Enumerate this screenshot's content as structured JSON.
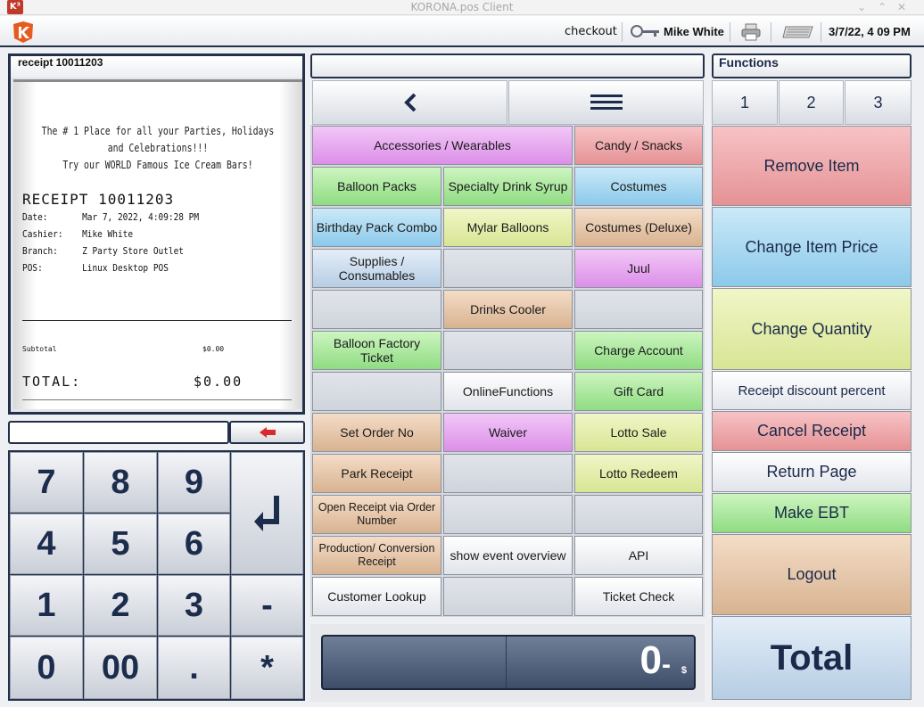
{
  "window": {
    "title": "KORONA.pos Client",
    "app_badge": "K³"
  },
  "header": {
    "mode": "checkout",
    "user": "Mike White",
    "datetime": "3/7/22, 4 09 PM"
  },
  "receipt": {
    "title": "receipt 10011203",
    "promo": [
      "The # 1 Place for all your Parties, Holidays",
      "and Celebrations!!!",
      "Try our WORLD Famous Ice Cream Bars!"
    ],
    "number_label": "RECEIPT 10011203",
    "fields": [
      {
        "k": "Date:",
        "v": "Mar 7, 2022, 4:09:28 PM"
      },
      {
        "k": "Cashier:",
        "v": "Mike White"
      },
      {
        "k": "Branch:",
        "v": "Z Party Store Outlet"
      },
      {
        "k": "POS:",
        "v": "Linux Desktop POS"
      }
    ],
    "subtotal_label": "Subtotal",
    "subtotal_value": "$0.00",
    "total_label": "TOTAL:",
    "total_value": "$0.00"
  },
  "keypad": {
    "keys": [
      "7",
      "8",
      "9",
      "4",
      "5",
      "6",
      "1",
      "2",
      "3",
      "-",
      "0",
      "00",
      ".",
      "*"
    ]
  },
  "products": {
    "buttons": [
      "Accessories / Wearables",
      "Candy / Snacks",
      "Balloon Packs",
      "Specialty Drink Syrup",
      "Costumes",
      "Birthday Pack Combo",
      "Mylar Balloons",
      "Costumes (Deluxe)",
      "Supplies / Consumables",
      "Juul",
      "Drinks Cooler",
      "Balloon Factory Ticket",
      "Charge Account",
      "OnlineFunctions",
      "Gift Card",
      "Set Order No",
      "Waiver",
      "Lotto Sale",
      "Park Receipt",
      "Lotto Redeem",
      "Open Receipt via Order Number",
      "Production/ Conversion Receipt",
      "show event overview",
      "API",
      "Customer Lookup",
      "Ticket Check"
    ]
  },
  "display": {
    "amount": "0",
    "decimals": "-",
    "currency": "$"
  },
  "functions": {
    "title": "Functions",
    "pages": [
      "1",
      "2",
      "3"
    ],
    "buttons": [
      "Remove Item",
      "Change Item Price",
      "Change Quantity",
      "Receipt discount percent",
      "Cancel Receipt",
      "Return Page",
      "Make EBT",
      "Logout",
      "Total"
    ]
  },
  "colors": {
    "frame": "#22304a",
    "purple": "#dc8fe8",
    "red": "#e59295",
    "green": "#8fdc82",
    "blue": "#8cc9ea",
    "yellow": "#d8e594",
    "tan": "#d8b391",
    "light_blue": "#b6cde4"
  }
}
